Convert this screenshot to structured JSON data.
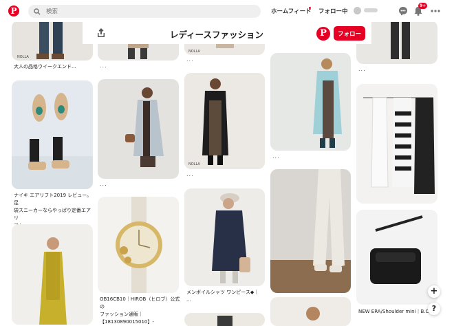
{
  "header": {
    "search_placeholder": "検索",
    "nav_home": "ホームフィード",
    "nav_following": "フォロー中",
    "notification_count": "9+"
  },
  "board": {
    "title": "レディースファッション",
    "follow_label": "フォロー"
  },
  "pins": [
    {
      "caption": "大人の品格ウイークエンド..."
    },
    {
      "caption": "ナイキ エアリフト2019 レビュー。足\n袋スニーカーならやっぱり定番エアリ\nフト"
    },
    {
      "caption": "OB16CB10｜HIROB（ヒロブ）公式の\nファッション通販｜\n【18130890015010】- BAYCREW'S..."
    },
    {
      "caption": "メンボイルシャツ ワンピース◆｜\n..."
    },
    {
      "caption": "NEW ERA/Shoulder mini｜B.C..."
    }
  ],
  "more_dots": "...",
  "colors": {
    "brand": "#e60023"
  },
  "icons": [
    "pinterest-logo-icon",
    "search-icon",
    "chat-icon",
    "bell-icon",
    "more-icon",
    "share-icon",
    "plus-icon",
    "help-icon"
  ],
  "fab": {
    "plus": "+",
    "help": "?"
  }
}
